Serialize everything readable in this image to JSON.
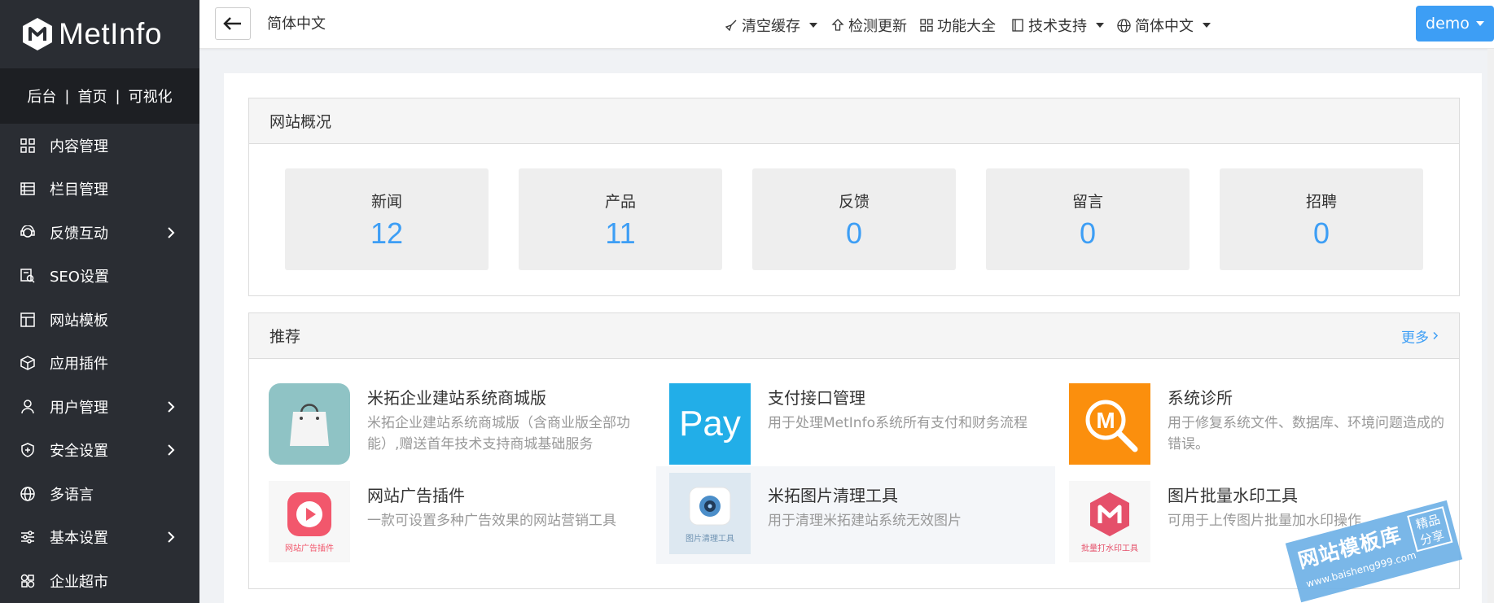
{
  "app": {
    "logo_text": "MetInfo",
    "brand_color": "#3d9ef5",
    "sidebar_bg": "#2a2d33"
  },
  "quick_links": {
    "backend": "后台",
    "home": "首页",
    "visual": "可视化",
    "separator": "|"
  },
  "sidebar": {
    "items": [
      {
        "label": "内容管理",
        "icon": "grid-icon",
        "has_children": false
      },
      {
        "label": "栏目管理",
        "icon": "list-icon",
        "has_children": false
      },
      {
        "label": "反馈互动",
        "icon": "feedback-icon",
        "has_children": true
      },
      {
        "label": "SEO设置",
        "icon": "seo-icon",
        "has_children": false
      },
      {
        "label": "网站模板",
        "icon": "template-icon",
        "has_children": false
      },
      {
        "label": "应用插件",
        "icon": "cube-icon",
        "has_children": false
      },
      {
        "label": "用户管理",
        "icon": "user-icon",
        "has_children": true
      },
      {
        "label": "安全设置",
        "icon": "shield-icon",
        "has_children": true
      },
      {
        "label": "多语言",
        "icon": "globe-icon",
        "has_children": false
      },
      {
        "label": "基本设置",
        "icon": "sliders-icon",
        "has_children": true
      },
      {
        "label": "企业超市",
        "icon": "store-icon",
        "has_children": false
      }
    ]
  },
  "header": {
    "title": "简体中文",
    "clear_cache": "清空缓存",
    "check_update": "检测更新",
    "features": "功能大全",
    "tech_support": "技术支持",
    "language": "简体中文",
    "user": "demo"
  },
  "overview": {
    "title": "网站概况",
    "stats": [
      {
        "label": "新闻",
        "value": "12"
      },
      {
        "label": "产品",
        "value": "11"
      },
      {
        "label": "反馈",
        "value": "0"
      },
      {
        "label": "留言",
        "value": "0"
      },
      {
        "label": "招聘",
        "value": "0"
      }
    ]
  },
  "recommend": {
    "title": "推荐",
    "more": "更多",
    "items": [
      {
        "title": "米拓企业建站系统商城版",
        "desc": "米拓企业建站系统商城版（含商业版全部功能）,赠送首年技术支持商城基础服务",
        "icon": "shopping-bag-icon"
      },
      {
        "title": "支付接口管理",
        "desc": "用于处理MetInfo系统所有支付和财务流程",
        "icon": "pay-icon",
        "icon_text": "Pay"
      },
      {
        "title": "系统诊所",
        "desc": "用于修复系统文件、数据库、环境问题造成的错误。",
        "icon": "magnifier-m-icon",
        "icon_text": "M"
      },
      {
        "title": "网站广告插件",
        "desc": "一款可设置多种广告效果的网站营销工具",
        "icon": "play-icon",
        "icon_caption": "网站广告插件"
      },
      {
        "title": "米拓图片清理工具",
        "desc": "用于清理米拓建站系统无效图片",
        "icon": "camera-icon",
        "icon_caption": "图片清理工具"
      },
      {
        "title": "图片批量水印工具",
        "desc": "可用于上传图片批量加水印操作",
        "icon": "cube-m-icon",
        "icon_caption": "批量打水印工具"
      }
    ]
  },
  "watermark": {
    "main": "网站模板库",
    "url": "www.baisheng999.com",
    "tag_line1": "精品",
    "tag_line2": "分享"
  }
}
